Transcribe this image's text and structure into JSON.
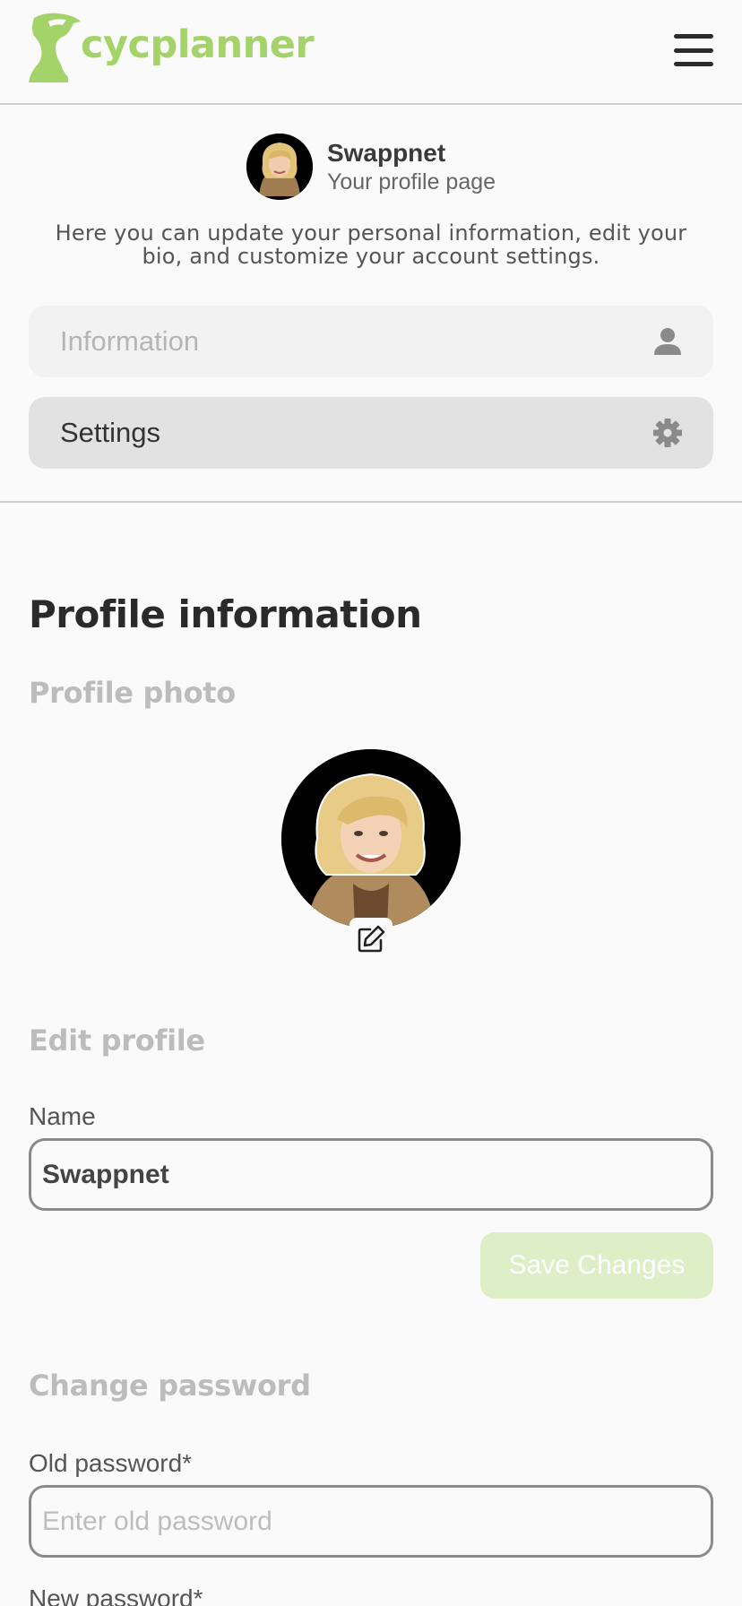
{
  "header": {
    "logo_text": "cycplanner",
    "brand_color": "#a4d36a",
    "menu_icon": "hamburger-icon"
  },
  "profile": {
    "name": "Swappnet",
    "subtitle": "Your profile page",
    "intro": "Here you can update your personal information, edit your bio, and customize your account settings."
  },
  "tabs": [
    {
      "label": "Information",
      "icon": "user-icon"
    },
    {
      "label": "Settings",
      "icon": "gear-icon"
    }
  ],
  "main": {
    "title": "Profile information",
    "photo_title": "Profile photo",
    "edit_title": "Edit profile",
    "name_label": "Name",
    "name_value": "Swappnet",
    "save_label": "Save Changes",
    "password_title": "Change password",
    "old_password_label": "Old password*",
    "old_password_placeholder": "Enter old password",
    "new_password_label": "New password*"
  }
}
